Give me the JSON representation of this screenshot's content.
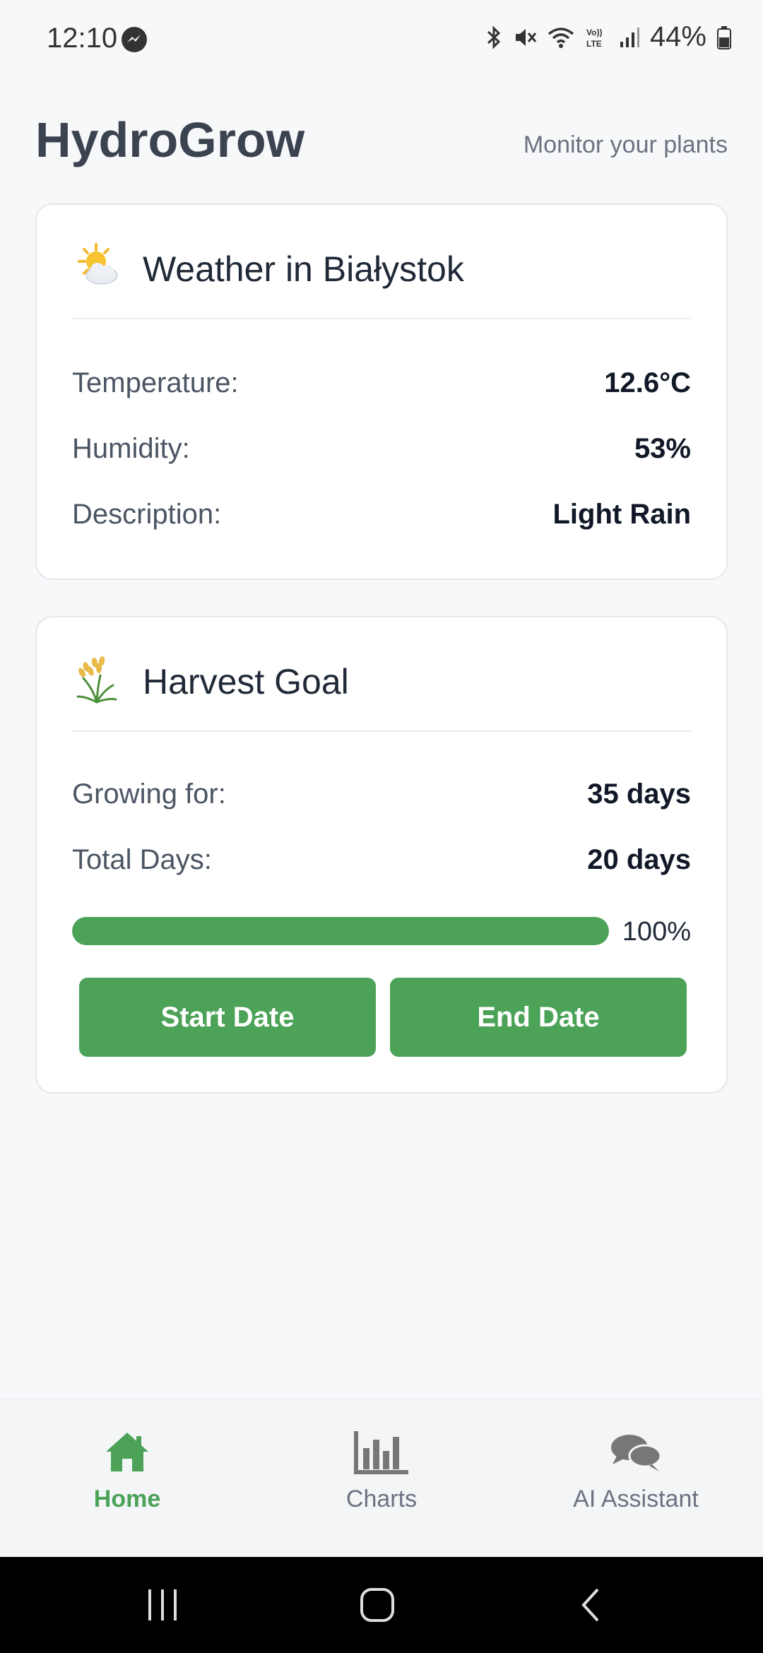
{
  "status_bar": {
    "time": "12:10",
    "battery": "44%",
    "icons": [
      "messenger-icon",
      "bluetooth-icon",
      "mute-icon",
      "wifi-icon",
      "volte-icon",
      "signal-icon",
      "battery-icon"
    ]
  },
  "header": {
    "title": "HydroGrow",
    "subtitle": "Monitor your plants"
  },
  "weather": {
    "emoji": "sun-behind-cloud-icon",
    "title": "Weather in Białystok",
    "rows": [
      {
        "label": "Temperature:",
        "value": "12.6°C"
      },
      {
        "label": "Humidity:",
        "value": "53%"
      },
      {
        "label": "Description:",
        "value": "Light Rain"
      }
    ]
  },
  "harvest": {
    "emoji": "rice-sheaf-icon",
    "title": "Harvest Goal",
    "rows": [
      {
        "label": "Growing for:",
        "value": "35 days"
      },
      {
        "label": "Total Days:",
        "value": "20 days"
      }
    ],
    "progress_percent": 100,
    "progress_text": "100%",
    "start_button": "Start Date",
    "end_button": "End Date"
  },
  "bottom_nav": {
    "items": [
      {
        "label": "Home",
        "icon": "home-icon",
        "active": true
      },
      {
        "label": "Charts",
        "icon": "bar-chart-icon",
        "active": false
      },
      {
        "label": "AI Assistant",
        "icon": "chat-bubbles-icon",
        "active": false
      }
    ]
  },
  "colors": {
    "accent": "#4ca358",
    "background": "#f7f8fa",
    "title": "#3b4351"
  }
}
